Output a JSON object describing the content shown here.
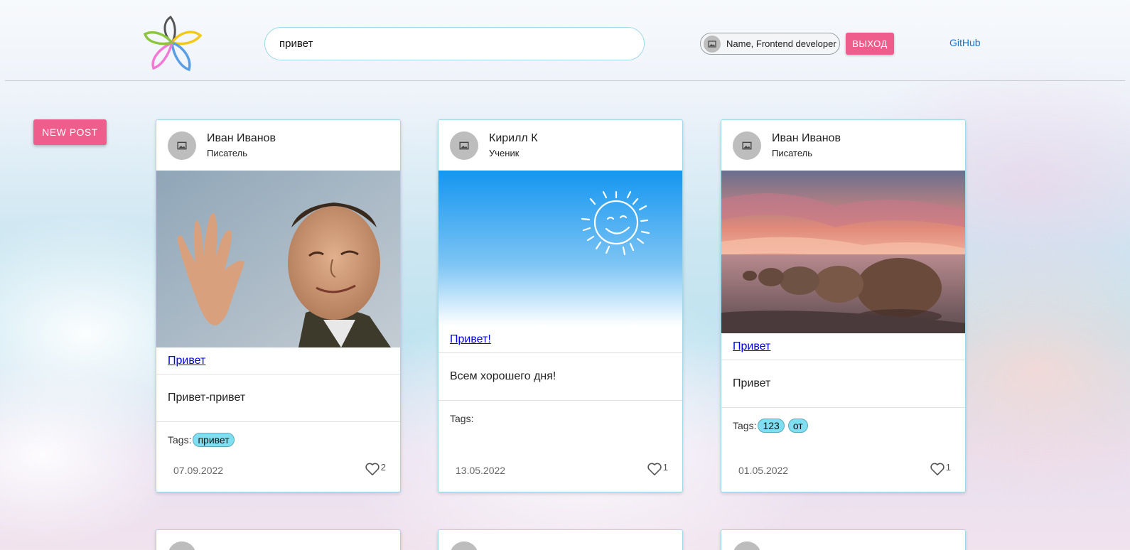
{
  "header": {
    "search": {
      "value": "привет",
      "placeholder": ""
    },
    "user_chip_label": "Name, Frontend developer",
    "logout_label": "ВЫХОД",
    "github_label": "GitHub"
  },
  "new_post_label": "NEW POST",
  "tags_label": "Tags:",
  "colors": {
    "accent_pink": "#ef5d8c",
    "tag_cyan": "#7fdff0",
    "link_blue": "#0000ee",
    "github_blue": "#1976d2"
  },
  "posts": [
    {
      "author": "Иван Иванов",
      "role": "Писатель",
      "title": "Привет",
      "text": "Привет-привет",
      "tags": [
        "привет"
      ],
      "date": "07.09.2022",
      "likes": "2",
      "image": "portrait-photo"
    },
    {
      "author": "Кирилл К",
      "role": "Ученик",
      "title": "Привет!",
      "text": "Всем хорошего дня!",
      "tags": [],
      "date": "13.05.2022",
      "likes": "1",
      "image": "sky-sun-drawing"
    },
    {
      "author": "Иван Иванов",
      "role": "Писатель",
      "title": "Привет",
      "text": "Привет",
      "tags": [
        "123",
        "от"
      ],
      "date": "01.05.2022",
      "likes": "1",
      "image": "beach-boulders-sunset"
    }
  ]
}
